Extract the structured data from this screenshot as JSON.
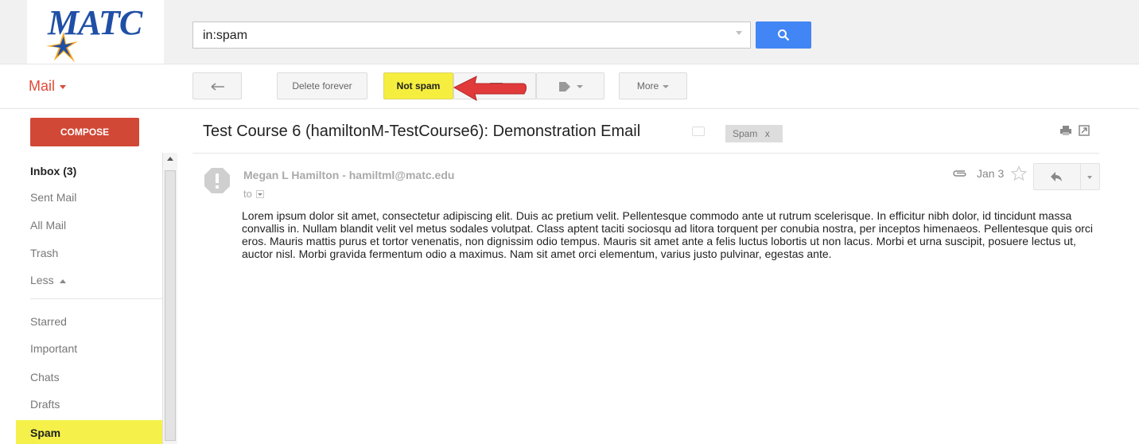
{
  "app": {
    "logo_text": "MATC",
    "accent_color": "#dd4b39"
  },
  "search": {
    "value": "in:spam"
  },
  "header": {
    "mail_label": "Mail"
  },
  "toolbar": {
    "back_icon": "back-arrow-icon",
    "delete_forever_label": "Delete forever",
    "not_spam_label": "Not spam",
    "more_label": "More"
  },
  "sidebar": {
    "compose_label": "COMPOSE",
    "items": [
      {
        "label": "Inbox (3)"
      },
      {
        "label": "Sent Mail"
      },
      {
        "label": "All Mail"
      },
      {
        "label": "Trash"
      },
      {
        "label": "Less"
      },
      {
        "label": "Starred"
      },
      {
        "label": "Important"
      },
      {
        "label": "Chats"
      },
      {
        "label": "Drafts"
      },
      {
        "label": "Spam"
      }
    ]
  },
  "message": {
    "subject": "Test Course 6 (hamiltonM-TestCourse6): Demonstration Email",
    "spam_chip": "Spam",
    "spam_chip_close": "x",
    "sender": "Megan L Hamilton - hamiltml@matc.edu",
    "to_label": "to",
    "date": "Jan 3",
    "body": "Lorem ipsum dolor sit amet, consectetur adipiscing elit. Duis ac pretium velit. Pellentesque commodo ante ut rutrum scelerisque. In efficitur nibh dolor, id tincidunt massa convallis in. Nullam blandit velit vel metus sodales volutpat. Class aptent taciti sociosqu ad litora torquent per conubia nostra, per inceptos himenaeos. Pellentesque quis orci eros. Mauris mattis purus et tortor venenatis, non dignissim odio tempus. Mauris sit amet ante a felis luctus lobortis ut non lacus. Morbi et urna suscipit, posuere lectus ut, auctor nisl. Morbi gravida fermentum odio a maximus. Nam sit amet orci elementum, varius justo pulvinar, egestas ante."
  },
  "annotation": {
    "arrow_color": "#e03a3a",
    "highlight_color": "#f5f14a"
  }
}
